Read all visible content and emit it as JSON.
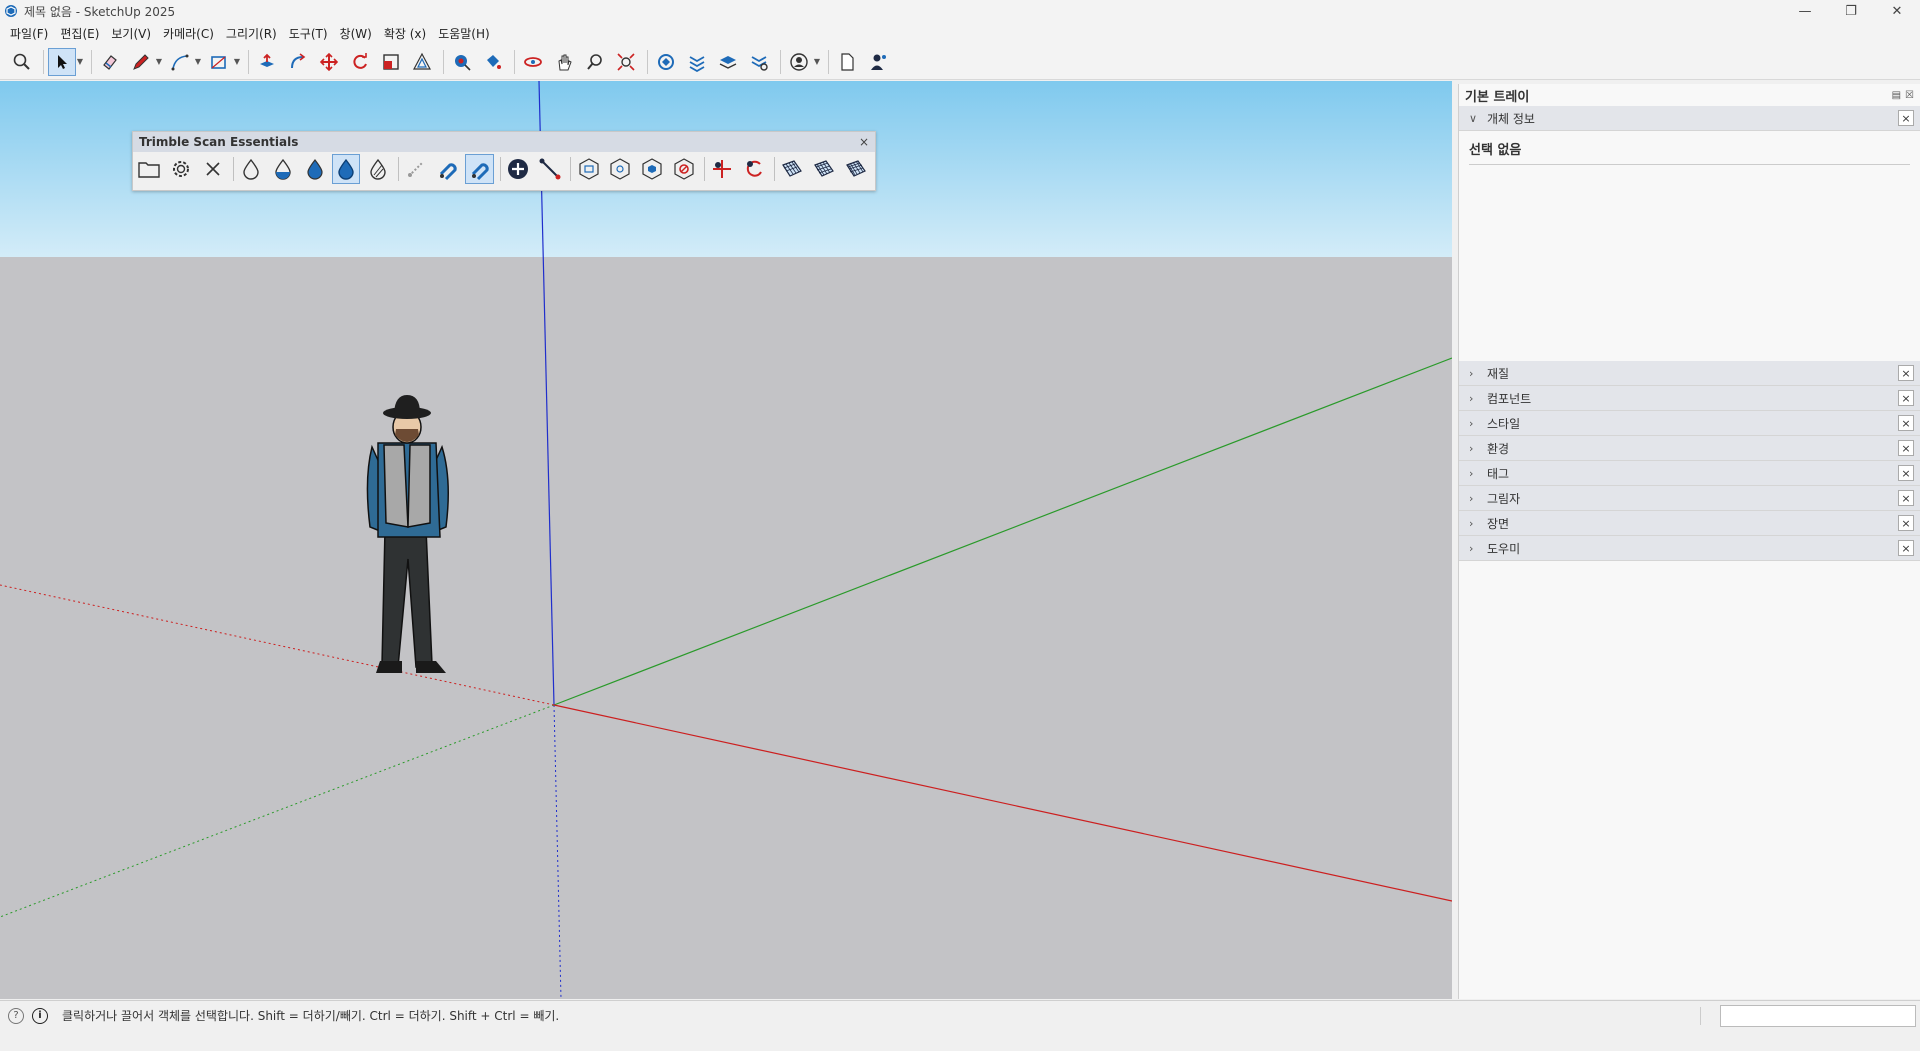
{
  "window": {
    "title": "제목 없음 - SketchUp 2025",
    "minimize_icon": "minimize-icon",
    "maximize_icon": "restore-icon",
    "close_icon": "close-icon"
  },
  "menu": {
    "items": [
      "파일(F)",
      "편집(E)",
      "보기(V)",
      "카메라(C)",
      "그리기(R)",
      "도구(T)",
      "창(W)",
      "확장 (x)",
      "도움말(H)"
    ]
  },
  "toolbar": {
    "tools": [
      "search-icon",
      "select-icon",
      "eraser-icon",
      "pencil-icon",
      "line-icon",
      "rectangle-icon",
      "push-pull-icon",
      "follow-me-icon",
      "move-icon",
      "rotate-icon",
      "scale-icon",
      "offset-icon",
      "tape-measure-icon",
      "paint-bucket-icon",
      "orbit-icon",
      "pan-icon",
      "zoom-icon",
      "zoom-extents-icon",
      "warehouse-icon",
      "extension-warehouse-icon",
      "layout-icon",
      "style-builder-icon",
      "account-icon",
      "new-file-icon",
      "profile-icon"
    ],
    "active_tool": "select-icon"
  },
  "scan_panel": {
    "title": "Trimble Scan Essentials",
    "close": "×"
  },
  "tray": {
    "title": "기본 트레이",
    "entity_info": {
      "label": "개체 정보",
      "selection": "선택 없음"
    },
    "sections": [
      "재질",
      "컴포넌트",
      "스타일",
      "환경",
      "태그",
      "그림자",
      "장면",
      "도우미"
    ],
    "close_glyph": "×"
  },
  "status": {
    "text": "클릭하거나 끌어서 객체를 선택합니다. Shift = 더하기/빼기. Ctrl = 더하기. Shift + Ctrl = 빼기.",
    "help_glyph": "?",
    "info_glyph": "i"
  },
  "colors": {
    "sky_top": "#7fc9ee",
    "sky_bottom": "#d3ecf8",
    "ground": "#c3c3c6",
    "axis_red": "#cc1f1f",
    "axis_green": "#2a9a2a",
    "axis_blue": "#1f2ecc",
    "accent": "#1e6bb8"
  }
}
